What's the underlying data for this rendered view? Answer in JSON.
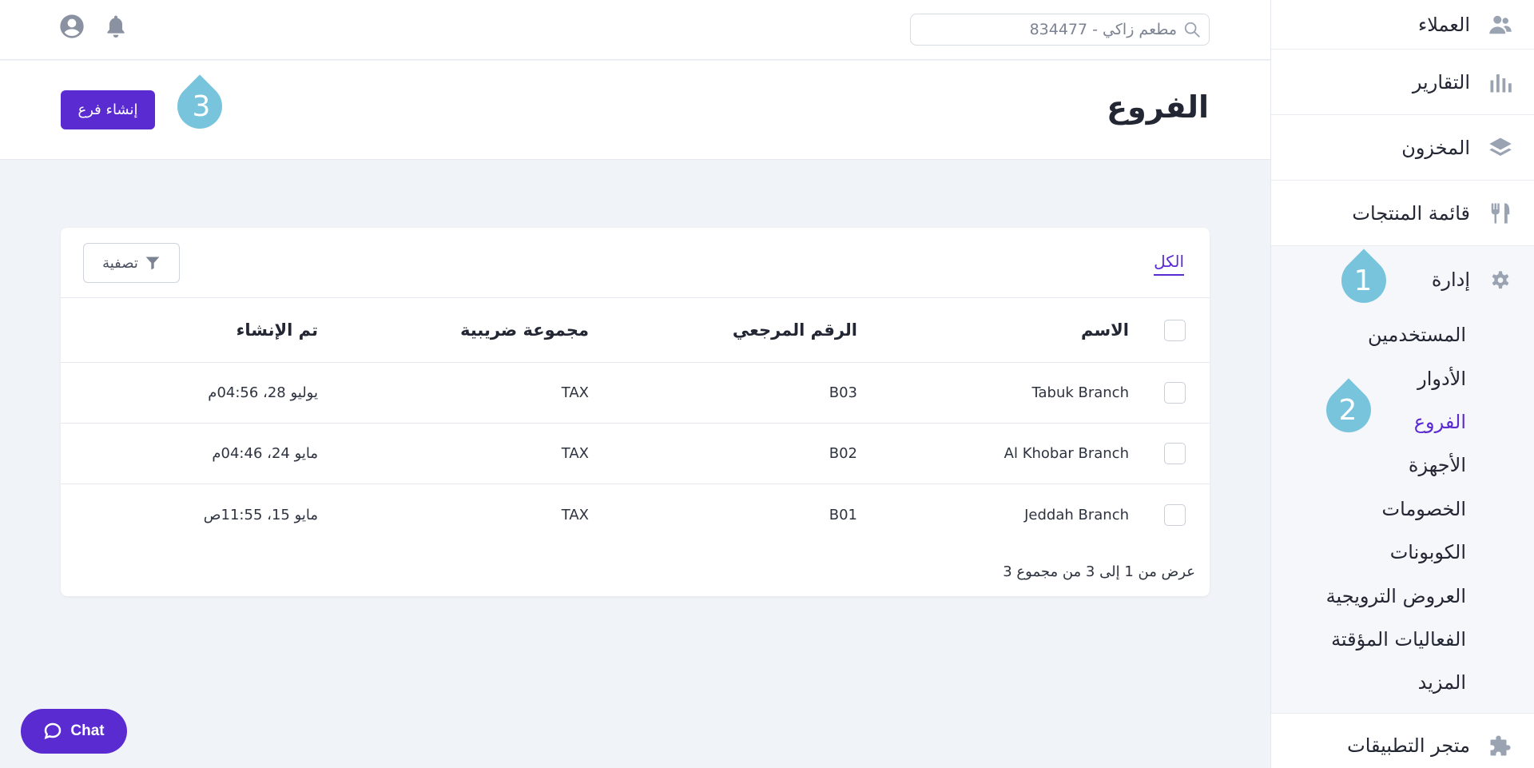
{
  "sidebar": {
    "items_top": [
      {
        "label": "العملاء",
        "icon": "users-icon"
      },
      {
        "label": "التقارير",
        "icon": "bar-chart-icon"
      },
      {
        "label": "المخزون",
        "icon": "layers-icon"
      },
      {
        "label": "قائمة المنتجات",
        "icon": "utensils-icon"
      }
    ],
    "admin": {
      "label": "إدارة",
      "icon": "gear-icon",
      "sub_items": [
        "المستخدمين",
        "الأدوار",
        "الفروع",
        "الأجهزة",
        "الخصومات",
        "الكوبونات",
        "العروض الترويجية",
        "الفعاليات المؤقتة",
        "المزيد"
      ],
      "active": "الفروع"
    },
    "app_store": {
      "label": "متجر التطبيقات",
      "icon": "puzzle-icon"
    }
  },
  "topbar": {
    "search_placeholder": "مطعم زاكي - 834477"
  },
  "page": {
    "title": "الفروع",
    "create_button": "إنشاء فرع"
  },
  "callouts": [
    "1",
    "2",
    "3"
  ],
  "table": {
    "tab_all": "الكل",
    "filter_label": "تصفية",
    "headers": {
      "name": "الاسم",
      "ref": "الرقم المرجعي",
      "tax": "مجموعة ضريبية",
      "created": "تم الإنشاء"
    },
    "rows": [
      {
        "name": "Tabuk Branch",
        "ref": "B03",
        "tax": "TAX",
        "created": "يوليو 28، 04:56م"
      },
      {
        "name": "Al Khobar Branch",
        "ref": "B02",
        "tax": "TAX",
        "created": "مايو 24، 04:46م"
      },
      {
        "name": "Jeddah Branch",
        "ref": "B01",
        "tax": "TAX",
        "created": "مايو 15، 11:55ص"
      }
    ],
    "pagination": "عرض من 1 إلى 3 من مجموع 3"
  },
  "chat": {
    "label": "Chat"
  },
  "colors": {
    "accent": "#5b2bd2",
    "callout": "#79c4dd"
  }
}
